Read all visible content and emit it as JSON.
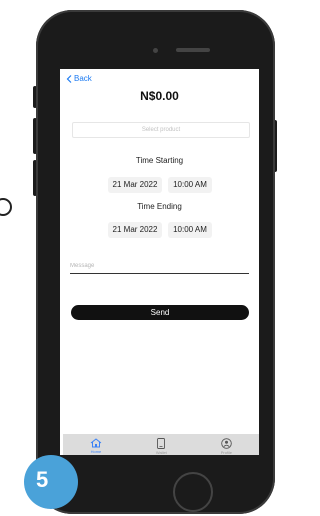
{
  "header": {
    "back_label": "Back",
    "title": "N$0.00"
  },
  "product_select": {
    "placeholder": "Select product"
  },
  "time_starting": {
    "label": "Time Starting",
    "date": "21 Mar 2022",
    "time": "10:00 AM"
  },
  "time_ending": {
    "label": "Time Ending",
    "date": "21 Mar 2022",
    "time": "10:00 AM"
  },
  "message": {
    "placeholder": "Message",
    "value": ""
  },
  "send_label": "Send",
  "tabs": [
    {
      "label": "Home",
      "icon": "home-icon",
      "active": true
    },
    {
      "label": "Wallet",
      "icon": "wallet-icon",
      "active": false
    },
    {
      "label": "Profile",
      "icon": "profile-icon",
      "active": false
    }
  ],
  "step_badge": "5",
  "colors": {
    "accent": "#1e7cf2",
    "tab_active": "#3b82f6",
    "badge": "#4aa2d9",
    "button": "#111111"
  }
}
